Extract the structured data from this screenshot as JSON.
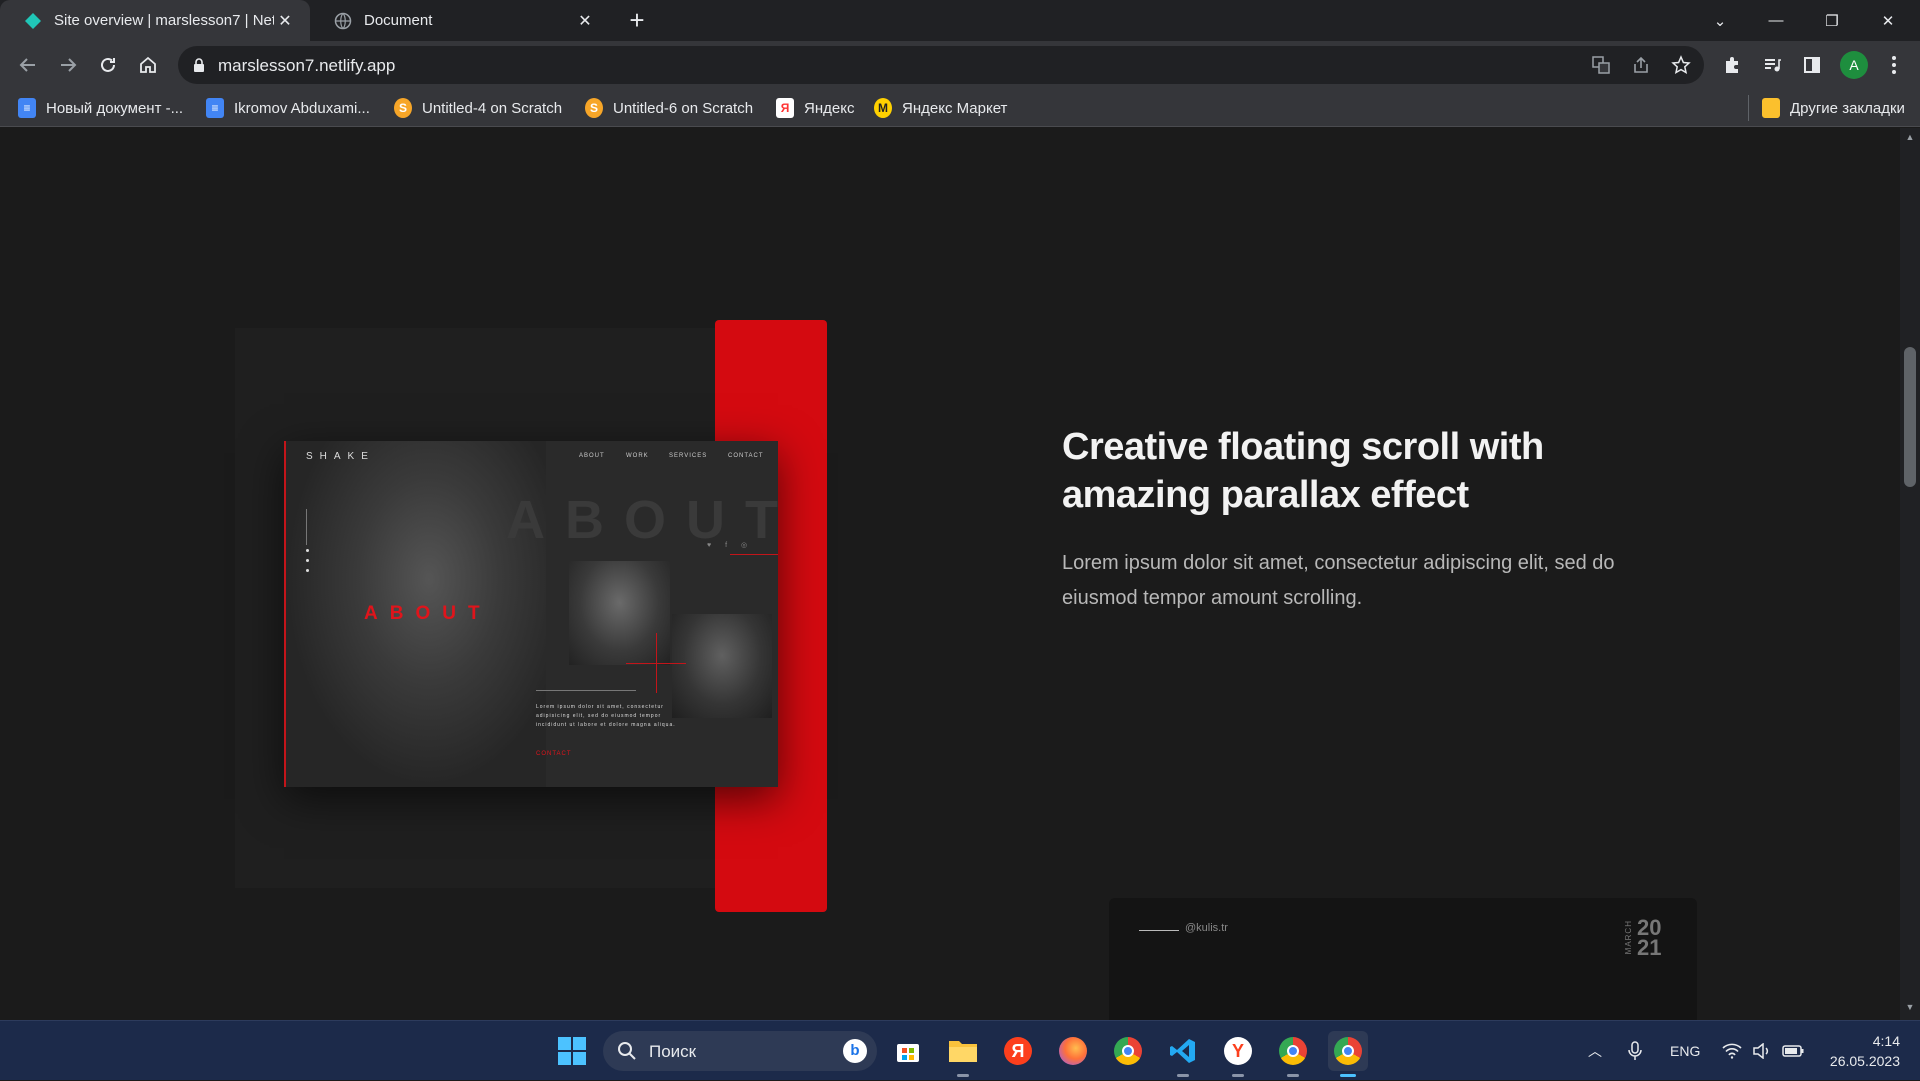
{
  "browser": {
    "tabs": [
      {
        "title": "Site overview | marslesson7 | Net",
        "active": true
      },
      {
        "title": "Document",
        "active": false
      }
    ],
    "url": "marslesson7.netlify.app",
    "profile_initial": "A",
    "bookmarks": [
      {
        "label": "Новый документ -...",
        "icon": "google-docs-icon"
      },
      {
        "label": "Ikromov Abduxami...",
        "icon": "google-docs-icon"
      },
      {
        "label": "Untitled-4 on Scratch",
        "icon": "scratch-icon"
      },
      {
        "label": "Untitled-6 on Scratch",
        "icon": "scratch-icon"
      },
      {
        "label": "Яндекс",
        "icon": "yandex-icon"
      },
      {
        "label": "Яндекс Маркет",
        "icon": "yandex-market-icon"
      }
    ],
    "other_bookmarks": "Другие закладки"
  },
  "page": {
    "headline": "Creative floating scroll with amazing parallax effect",
    "paragraph": "Lorem ipsum dolor sit amet, consectetur adipiscing elit, sed do eiusmod tempor amount scrolling.",
    "mockup": {
      "logo": "SHAKE",
      "nav": [
        "ABOUT",
        "WORK",
        "SERVICES",
        "CONTACT"
      ],
      "big_word": "ABOUT",
      "red_word": "ABOUT",
      "text": "Lorem ipsum dolor sit amet, consectetur adipisicing elit, sed do eiusmod tempor incididunt ut labore et dolore magna aliqua.",
      "contact": "CONTACT",
      "social": "♥ f ◎"
    },
    "bottom_card": {
      "handle": "@kulis.tr",
      "month": "MARCH",
      "year_top": "20",
      "year_bottom": "21"
    }
  },
  "taskbar": {
    "search_placeholder": "Поиск",
    "language": "ENG",
    "time": "4:14",
    "date": "26.05.2023"
  },
  "colors": {
    "accent_red": "#d40a10",
    "bg_dark": "#1b1b1b",
    "chrome_dark": "#35363a"
  }
}
